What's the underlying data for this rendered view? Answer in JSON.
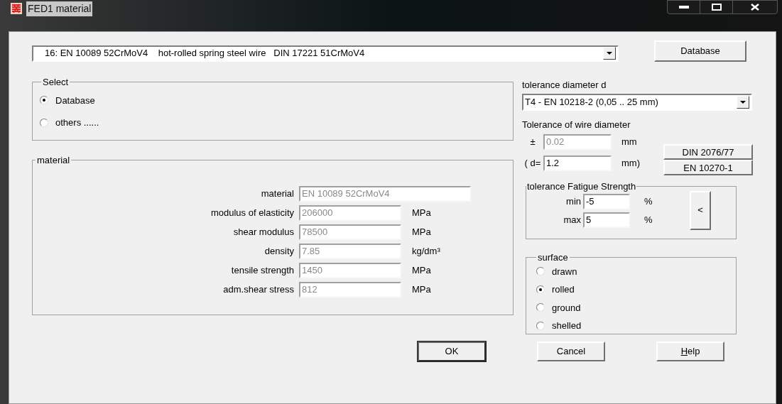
{
  "window": {
    "title": "FED1 material"
  },
  "material_combo": {
    "value": "16: EN 10089 52CrMoV4    hot-rolled spring steel wire   DIN 17221 51CrMoV4"
  },
  "database_button": "Database",
  "select_group": {
    "title": "Select",
    "options": [
      {
        "label": "Database",
        "selected": true
      },
      {
        "label": "others ......",
        "selected": false
      }
    ]
  },
  "material_group": {
    "title": "material",
    "fields": [
      {
        "label": "material",
        "value": "EN 10089 52CrMoV4",
        "kind": "wide",
        "disabled": true
      },
      {
        "label": "modulus of elasticity",
        "value": "206000",
        "unit": "MPa",
        "kind": "unit",
        "disabled": true
      },
      {
        "label": "shear modulus",
        "value": "78500",
        "unit": "MPa",
        "kind": "unit",
        "disabled": true
      },
      {
        "label": "density",
        "value": "7.85",
        "unit": "kg/dm³",
        "kind": "unit",
        "disabled": true
      },
      {
        "label": "tensile strength",
        "value": "1450",
        "unit": "MPa",
        "kind": "unit",
        "disabled": true
      },
      {
        "label": "adm.shear stress",
        "value": "812",
        "unit": "MPa",
        "kind": "unit",
        "disabled": true
      }
    ]
  },
  "tolerance_diameter": {
    "label": "tolerance diameter d",
    "value": "T4 - EN 10218-2 (0,05 .. 25 mm)"
  },
  "wire_tolerance": {
    "label": "Tolerance of wire diameter",
    "rows": [
      {
        "prefix": "±",
        "value": "0.02",
        "unit": "mm",
        "disabled": true
      },
      {
        "prefix": "( d=",
        "value": "1.2",
        "unit": "mm)",
        "disabled": false
      }
    ],
    "buttons": [
      "DIN 2076/77",
      "EN 10270-1"
    ]
  },
  "fatigue": {
    "title": "tolerance Fatigue Strength",
    "rows": [
      {
        "label": "min",
        "value": "-5",
        "unit": "%"
      },
      {
        "label": "max",
        "value": "5",
        "unit": "%"
      }
    ],
    "button": "<"
  },
  "surface": {
    "title": "surface",
    "options": [
      {
        "label": "drawn",
        "selected": false
      },
      {
        "label": "rolled",
        "selected": true
      },
      {
        "label": "ground",
        "selected": false
      },
      {
        "label": "shelled",
        "selected": false
      }
    ]
  },
  "buttons": [
    {
      "label": "OK",
      "default": true,
      "mnemonic": false
    },
    {
      "label": "Cancel",
      "default": false,
      "mnemonic": false
    },
    {
      "label": "Help",
      "default": false,
      "mnemonic": true
    }
  ]
}
